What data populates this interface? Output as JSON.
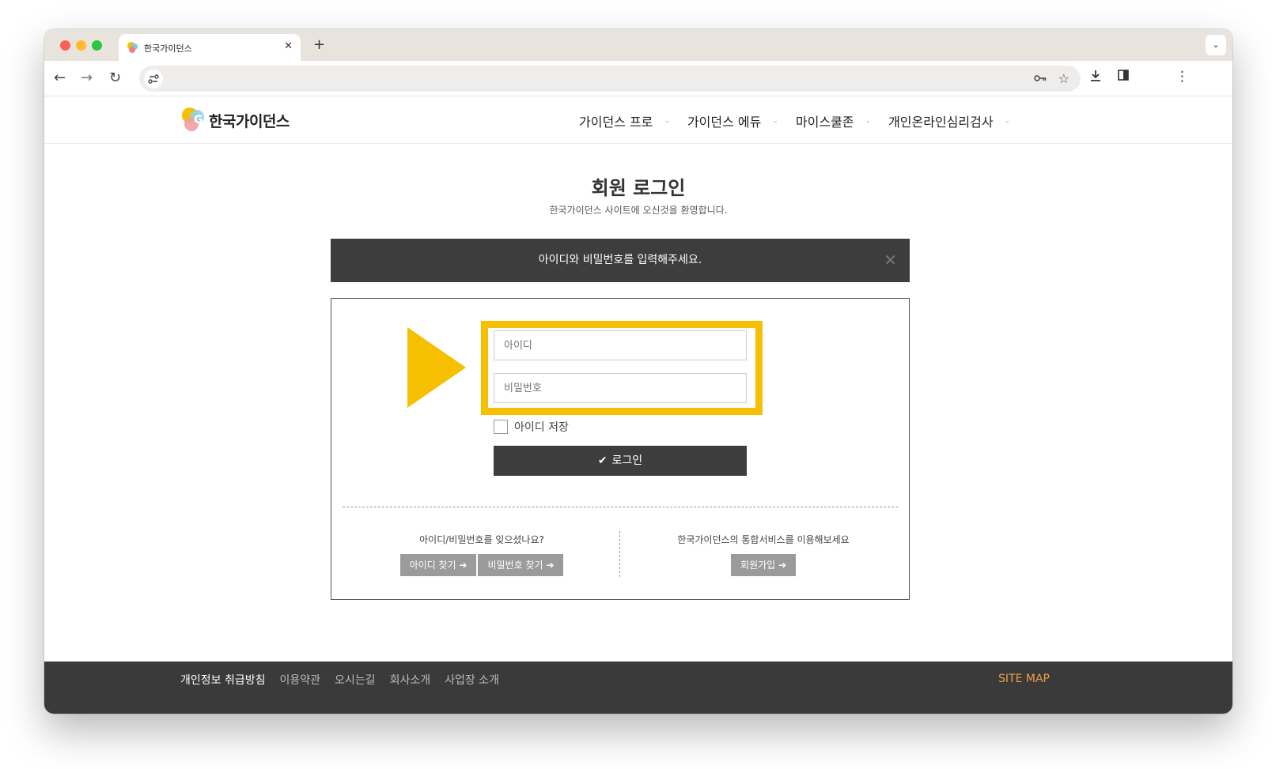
{
  "browser": {
    "tab_title": "한국가이던스",
    "tab_close": "✕",
    "new_tab": "+",
    "dropdown": "⌄"
  },
  "site": {
    "logo_text": "한국가이던스",
    "nav": [
      {
        "label": "가이던스 프로"
      },
      {
        "label": "가이던스 에듀"
      },
      {
        "label": "마이스쿨존"
      },
      {
        "label": "개인온라인심리검사"
      }
    ],
    "nav_caret": "⌄"
  },
  "login": {
    "title": "회원 로그인",
    "subtitle": "한국가이던스 사이트에 오신것을 환영합니다.",
    "alert_text": "아이디와 비밀번호를 입력해주세요.",
    "id_placeholder": "아이디",
    "pw_placeholder": "비밀번호",
    "remember_label": "아이디 저장",
    "login_button": "로그인",
    "forgot_text": "아이디/비밀번호를 잊으셨나요?",
    "find_id": "아이디 찾기 ➔",
    "find_pw": "비밀번호 찾기 ➔",
    "join_text": "한국가이던스의 통합서비스를 이용해보세요",
    "join_button": "회원가입 ➔"
  },
  "footer": {
    "links": [
      "개인정보 취급방침",
      "이용약관",
      "오시는길",
      "회사소개",
      "사업장 소개"
    ],
    "sitemap": "SITE MAP"
  },
  "colors": {
    "highlight": "#f6c000",
    "dark": "#3d3d3d",
    "sitemap": "#e8a040"
  },
  "icons": [
    "back-arrow-icon",
    "forward-arrow-icon",
    "reload-icon",
    "site-info-icon",
    "key-icon",
    "star-icon",
    "download-icon",
    "sidebar-icon",
    "menu-icon",
    "check-icon",
    "close-icon"
  ]
}
